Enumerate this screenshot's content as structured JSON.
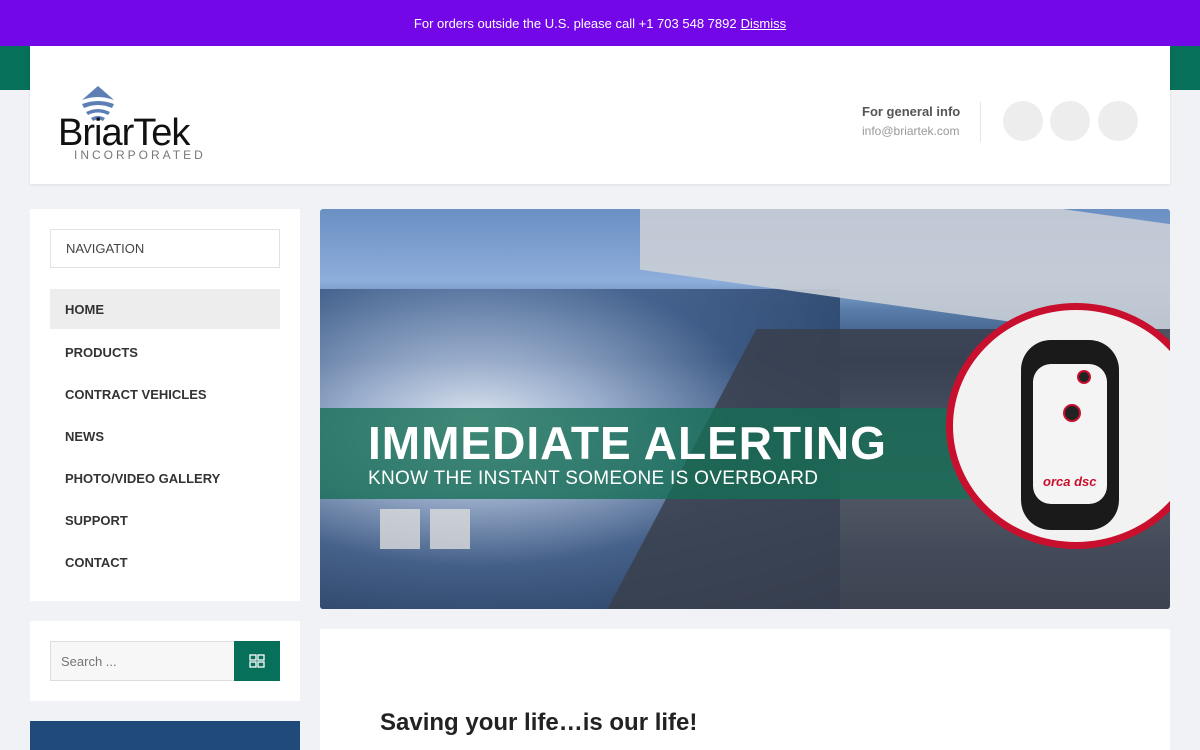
{
  "notice": {
    "text": "For orders outside the U.S. please call +1 703 548 7892",
    "dismiss": "Dismiss"
  },
  "header": {
    "logo_word": "BriarTek",
    "logo_sub": "INCORPORATED",
    "info_title": "For general info",
    "info_email": "info@briartek.com"
  },
  "nav": {
    "toggle_label": "NAVIGATION",
    "items": [
      {
        "label": "HOME"
      },
      {
        "label": "PRODUCTS"
      },
      {
        "label": "CONTRACT VEHICLES"
      },
      {
        "label": "NEWS"
      },
      {
        "label": "PHOTO/VIDEO GALLERY"
      },
      {
        "label": "SUPPORT"
      },
      {
        "label": "CONTACT"
      }
    ]
  },
  "search": {
    "placeholder": "Search ..."
  },
  "hero": {
    "title": "IMMEDIATE ALERTING",
    "subtitle": "KNOW THE INSTANT SOMEONE IS OVERBOARD",
    "device_label": "orca dsc"
  },
  "content": {
    "heading": "Saving your life…is our life!"
  },
  "colors": {
    "notice_bg": "#7407e8",
    "accent_green": "#07705a",
    "brand_blue": "#1f4a7a"
  }
}
